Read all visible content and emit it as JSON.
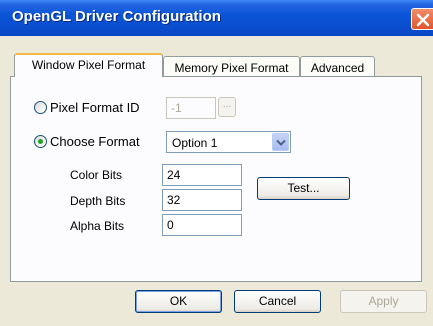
{
  "window": {
    "title": "OpenGL Driver Configuration"
  },
  "tabs": [
    {
      "label": "Window Pixel Format",
      "active": true
    },
    {
      "label": "Memory Pixel Format",
      "active": false
    },
    {
      "label": "Advanced",
      "active": false
    }
  ],
  "pixel_format_id": {
    "label": "Pixel Format ID",
    "selected": false,
    "value": "-1",
    "browse_label": "..."
  },
  "choose_format": {
    "label": "Choose Format",
    "selected": true,
    "option": "Option 1"
  },
  "fields": {
    "color_bits": {
      "label": "Color Bits",
      "value": "24"
    },
    "depth_bits": {
      "label": "Depth Bits",
      "value": "32"
    },
    "alpha_bits": {
      "label": "Alpha Bits",
      "value": "0"
    }
  },
  "buttons": {
    "test": "Test...",
    "ok": "OK",
    "cancel": "Cancel",
    "apply": "Apply"
  },
  "colors": {
    "titlebar": "#0a4fd0",
    "selected_radio": "#21a121",
    "tab_highlight": "#f4b844"
  }
}
